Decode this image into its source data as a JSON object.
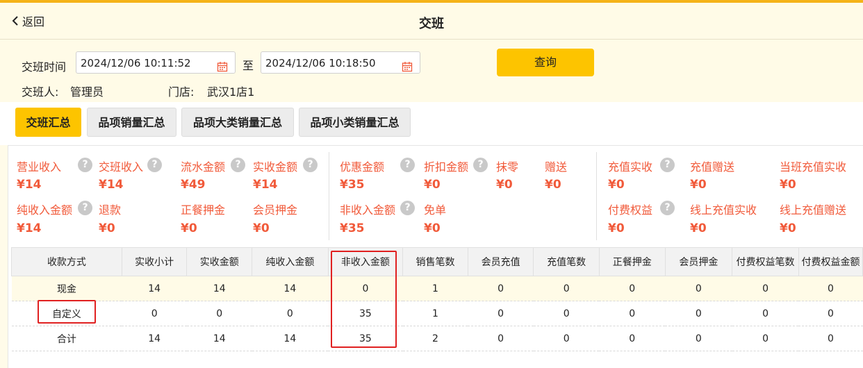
{
  "header": {
    "back_label": "返回",
    "title": "交班"
  },
  "filter": {
    "time_label": "交班时间",
    "start": "2024/12/06 10:11:52",
    "to_label": "至",
    "end": "2024/12/06 10:18:50",
    "query_label": "查询",
    "operator_label": "交班人:",
    "operator": "管理员",
    "store_label": "门店:",
    "store": "武汉1店1"
  },
  "tabs": [
    "交班汇总",
    "品项销量汇总",
    "品项大类销量汇总",
    "品项小类销量汇总"
  ],
  "stats": {
    "c1": {
      "labels": [
        "营业收入",
        "交班收入",
        "流水金额",
        "实收金额",
        "纯收入金额",
        "退款",
        "正餐押金",
        "会员押金"
      ],
      "values": [
        "¥14",
        "¥14",
        "¥49",
        "¥14",
        "¥14",
        "¥0",
        "¥0",
        "¥0"
      ]
    },
    "c2": {
      "labels": [
        "优惠金额",
        "折扣金额",
        "抹零",
        "赠送",
        "非收入金额",
        "免单"
      ],
      "values": [
        "¥35",
        "¥0",
        "¥0",
        "¥0",
        "¥35",
        "¥0"
      ]
    },
    "c3": {
      "labels": [
        "充值实收",
        "充值赠送",
        "当班充值实收",
        "付费权益",
        "线上充值实收",
        "线上充值赠送"
      ],
      "values": [
        "¥0",
        "¥0",
        "¥0",
        "¥0",
        "¥0",
        "¥0"
      ]
    },
    "help_glyph": "?"
  },
  "table": {
    "headers": [
      "收款方式",
      "实收小计",
      "实收金额",
      "纯收入金额",
      "非收入金额",
      "销售笔数",
      "会员充值",
      "充值笔数",
      "正餐押金",
      "会员押金",
      "付费权益笔数",
      "付费权益金额"
    ],
    "rows": [
      [
        "现金",
        "14",
        "14",
        "14",
        "0",
        "1",
        "0",
        "0",
        "0",
        "0",
        "0",
        "0"
      ],
      [
        "自定义",
        "0",
        "0",
        "0",
        "35",
        "1",
        "0",
        "0",
        "0",
        "0",
        "0",
        "0"
      ],
      [
        "合计",
        "14",
        "14",
        "14",
        "35",
        "2",
        "0",
        "0",
        "0",
        "0",
        "0",
        "0"
      ]
    ]
  },
  "colors": {
    "accent": "#fdc400",
    "stat_red": "#f15a3a",
    "annotation_red": "#e02020"
  }
}
